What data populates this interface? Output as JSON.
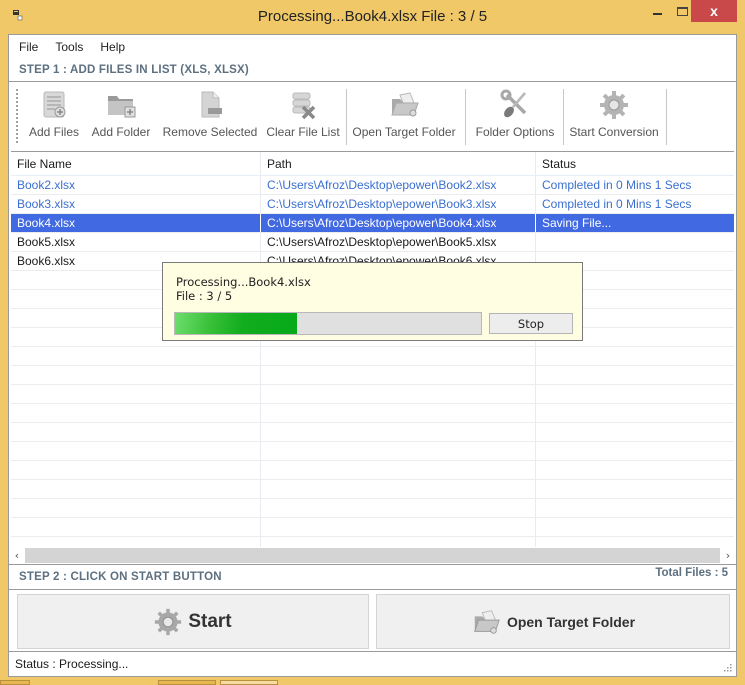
{
  "window": {
    "title": "Processing...Book4.xlsx File : 3 / 5",
    "minimize_label": "minimize",
    "maximize_label": "maximize",
    "close_label": "x"
  },
  "menu": [
    "File",
    "Tools",
    "Help"
  ],
  "step1_label": "STEP 1 : ADD FILES IN LIST (XLS, XLSX)",
  "toolbar": [
    {
      "label": "Add Files",
      "icon": "add-files-icon"
    },
    {
      "label": "Add Folder",
      "icon": "add-folder-icon"
    },
    {
      "label": "Remove Selected",
      "icon": "remove-selected-icon"
    },
    {
      "label": "Clear File List",
      "icon": "clear-list-icon"
    },
    {
      "label": "Open Target Folder",
      "icon": "open-folder-icon"
    },
    {
      "label": "Folder Options",
      "icon": "wrench-screwdriver-icon"
    },
    {
      "label": "Start Conversion",
      "icon": "gear-icon"
    }
  ],
  "table": {
    "columns": [
      "File Name",
      "Path",
      "Status"
    ],
    "rows": [
      {
        "name": "Book2.xlsx",
        "path": "C:\\Users\\Afroz\\Desktop\\epower\\Book2.xlsx",
        "status": "Completed in 0 Mins 1 Secs",
        "state": "done"
      },
      {
        "name": "Book3.xlsx",
        "path": "C:\\Users\\Afroz\\Desktop\\epower\\Book3.xlsx",
        "status": "Completed in 0 Mins 1 Secs",
        "state": "done"
      },
      {
        "name": "Book4.xlsx",
        "path": "C:\\Users\\Afroz\\Desktop\\epower\\Book4.xlsx",
        "status": "Saving File...",
        "state": "selected"
      },
      {
        "name": "Book5.xlsx",
        "path": "C:\\Users\\Afroz\\Desktop\\epower\\Book5.xlsx",
        "status": "",
        "state": "pending"
      },
      {
        "name": "Book6.xlsx",
        "path": "C:\\Users\\Afroz\\Desktop\\epower\\Book6.xlsx",
        "status": "",
        "state": "pending"
      }
    ]
  },
  "scroll": {
    "left": "‹",
    "right": "›"
  },
  "step2_label": "STEP 2 : CLICK ON START BUTTON",
  "total_files": "Total Files : 5",
  "start_button": "Start",
  "open_target_button": "Open Target Folder",
  "status_bar": "Status  :  Processing...",
  "progress_dialog": {
    "line1": "Processing...Book4.xlsx",
    "line2": "File : 3 / 5",
    "progress_percent": 40,
    "stop_label": "Stop"
  },
  "colors": {
    "frame": "#f0c868",
    "close": "#c9494a",
    "selected_row": "#4169e1",
    "done_text": "#3a6fd0",
    "step_text": "#5d7080",
    "progress": "#06aa1a",
    "popup_bg": "#fffde2"
  }
}
